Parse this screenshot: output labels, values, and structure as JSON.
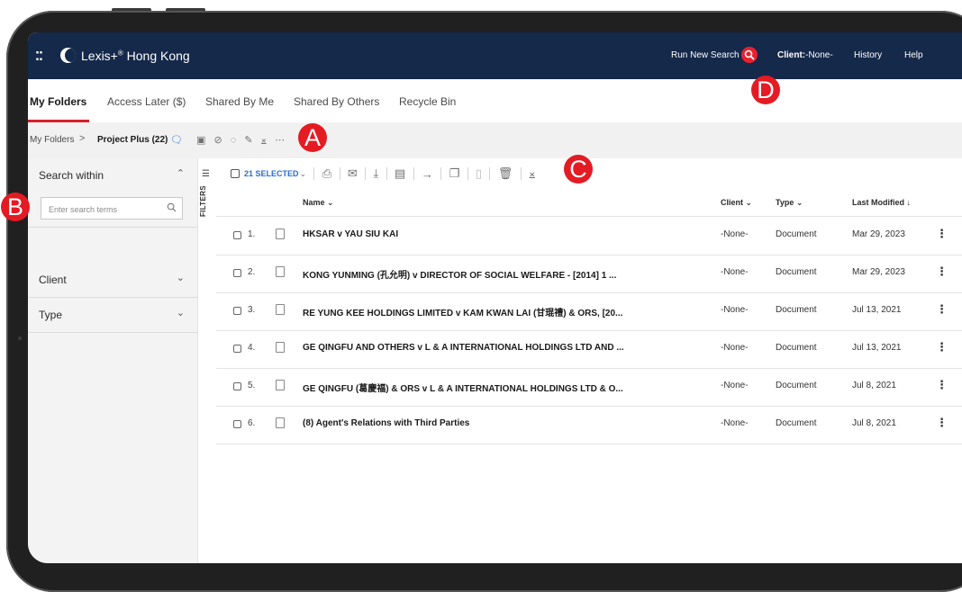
{
  "header": {
    "brand_name": "Lexis+",
    "brand_suffix": "Hong Kong",
    "brand_mark": "®",
    "grid_menu_glyph": "⁚⁚",
    "run_new_search": "Run New Search",
    "client_label": "Client:",
    "client_value": "-None-",
    "history": "History",
    "help": "Help"
  },
  "tabs": [
    {
      "label": "My Folders",
      "active": true
    },
    {
      "label": "Access Later ($)",
      "active": false
    },
    {
      "label": "Shared By Me",
      "active": false
    },
    {
      "label": "Shared By Others",
      "active": false
    },
    {
      "label": "Recycle Bin",
      "active": false
    }
  ],
  "breadcrumb": {
    "root": "My Folders",
    "separator": ">",
    "current": "Project Plus (22)"
  },
  "filters": {
    "tab_label": "FILTERS",
    "search_within_title": "Search within",
    "search_placeholder": "Enter search terms",
    "sections": [
      "Client",
      "Type"
    ]
  },
  "toolbar": {
    "selected_label": "21 SELECTED"
  },
  "columns": {
    "name": "Name",
    "client": "Client",
    "type": "Type",
    "last_modified": "Last Modified ↓"
  },
  "rows": [
    {
      "num": "1.",
      "title": "HKSAR v YAU SIU KAI",
      "client": "-None-",
      "type": "Document",
      "modified": "Mar 29, 2023"
    },
    {
      "num": "2.",
      "title": "KONG YUNMING (孔允明) v DIRECTOR OF SOCIAL WELFARE - [2014] 1 ...",
      "client": "-None-",
      "type": "Document",
      "modified": "Mar 29, 2023"
    },
    {
      "num": "3.",
      "title": "RE YUNG KEE HOLDINGS LIMITED v KAM KWAN LAI (甘琨禮) & ORS, [20...",
      "client": "-None-",
      "type": "Document",
      "modified": "Jul 13, 2021"
    },
    {
      "num": "4.",
      "title": "GE QINGFU AND OTHERS v L & A INTERNATIONAL HOLDINGS LTD AND ...",
      "client": "-None-",
      "type": "Document",
      "modified": "Jul 13, 2021"
    },
    {
      "num": "5.",
      "title": "GE QINGFU (葛慶福) & ORS v L & A INTERNATIONAL HOLDINGS LTD & O...",
      "client": "-None-",
      "type": "Document",
      "modified": "Jul 8, 2021"
    },
    {
      "num": "6.",
      "title": "(8) Agent's Relations with Third Parties",
      "client": "-None-",
      "type": "Document",
      "modified": "Jul 8, 2021"
    }
  ],
  "callouts": [
    "A",
    "B",
    "C",
    "D"
  ],
  "colors": {
    "header_bg": "#15294a",
    "accent_red": "#e41b23",
    "link_blue": "#2a6fd1"
  }
}
